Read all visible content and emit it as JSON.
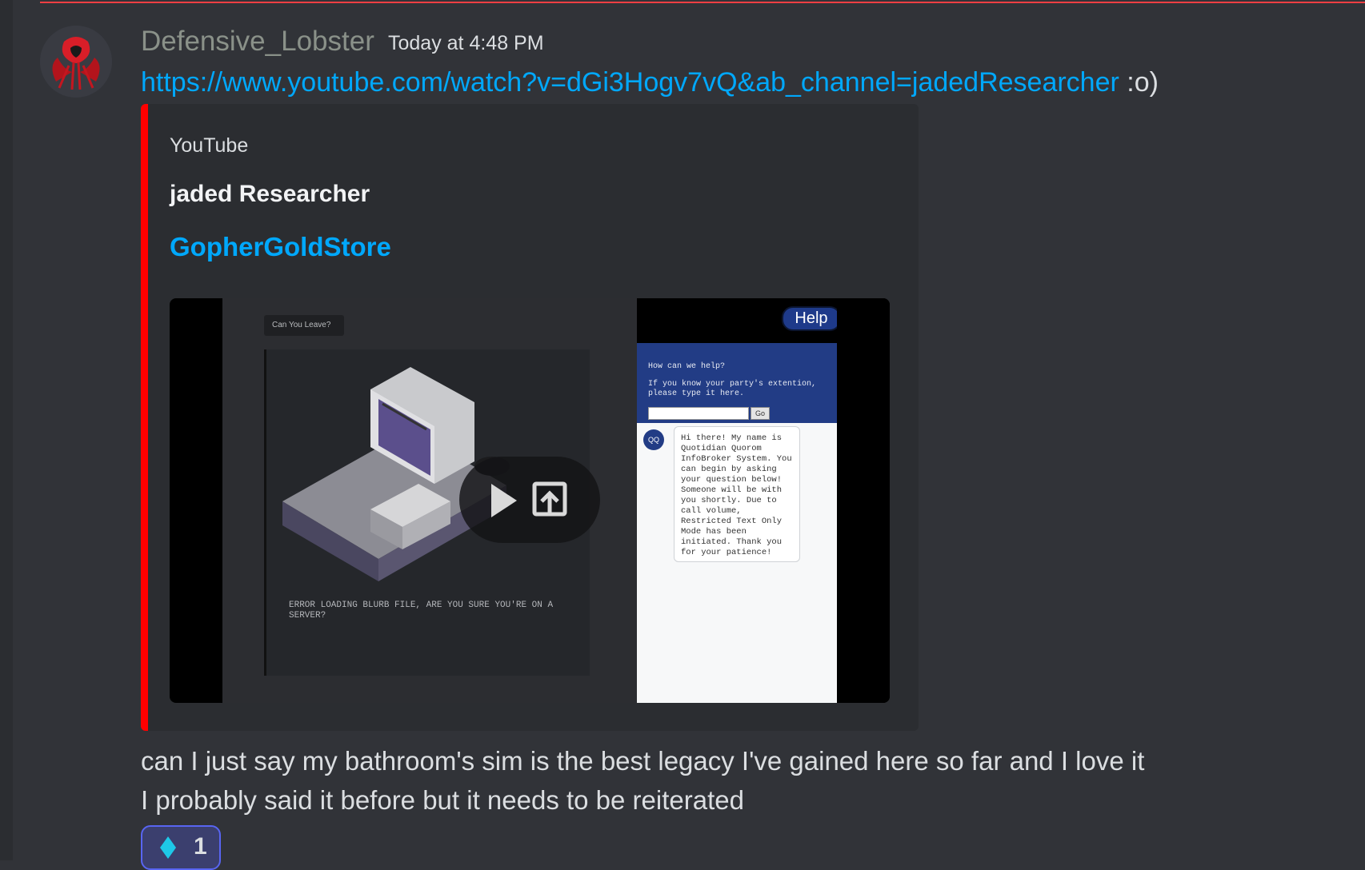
{
  "message": {
    "username": "Defensive_Lobster",
    "timestamp": "Today at 4:48 PM",
    "link_text": "https://www.youtube.com/watch?v=dGi3Hogv7vQ&ab_channel=jadedResearcher",
    "link_suffix": ":o)"
  },
  "embed": {
    "provider": "YouTube",
    "author": "jaded Researcher",
    "title": "GopherGoldStore",
    "accent_color": "#ff0000",
    "thumbnail": {
      "dropdown_label": "Can You Leave?",
      "help_label": "Help",
      "error_text": "ERROR LOADING BLURB FILE, ARE YOU SURE YOU'RE ON A SERVER?",
      "chat_question": "How can we help?",
      "chat_instruction": "If you know your party's extention, please type it here.",
      "chat_go": "Go",
      "chat_badge": "QQ",
      "chat_message": "Hi there! My name is Quotidian Quorom InfoBroker System. You can begin by asking your question below! Someone will be with you shortly. Due to call volume, Restricted Text Only Mode has been initiated. Thank you for your patience!"
    }
  },
  "body_lines": [
    "can I just say my bathroom's sim is the best legacy I've gained here so far and I love it",
    "I probably said it before but it needs to be reiterated"
  ],
  "reaction": {
    "icon": "diamond-icon",
    "count": "1"
  },
  "colors": {
    "background": "#313338",
    "link": "#00a8fc",
    "username": "#8a9189",
    "reaction_border": "#5865f2"
  }
}
